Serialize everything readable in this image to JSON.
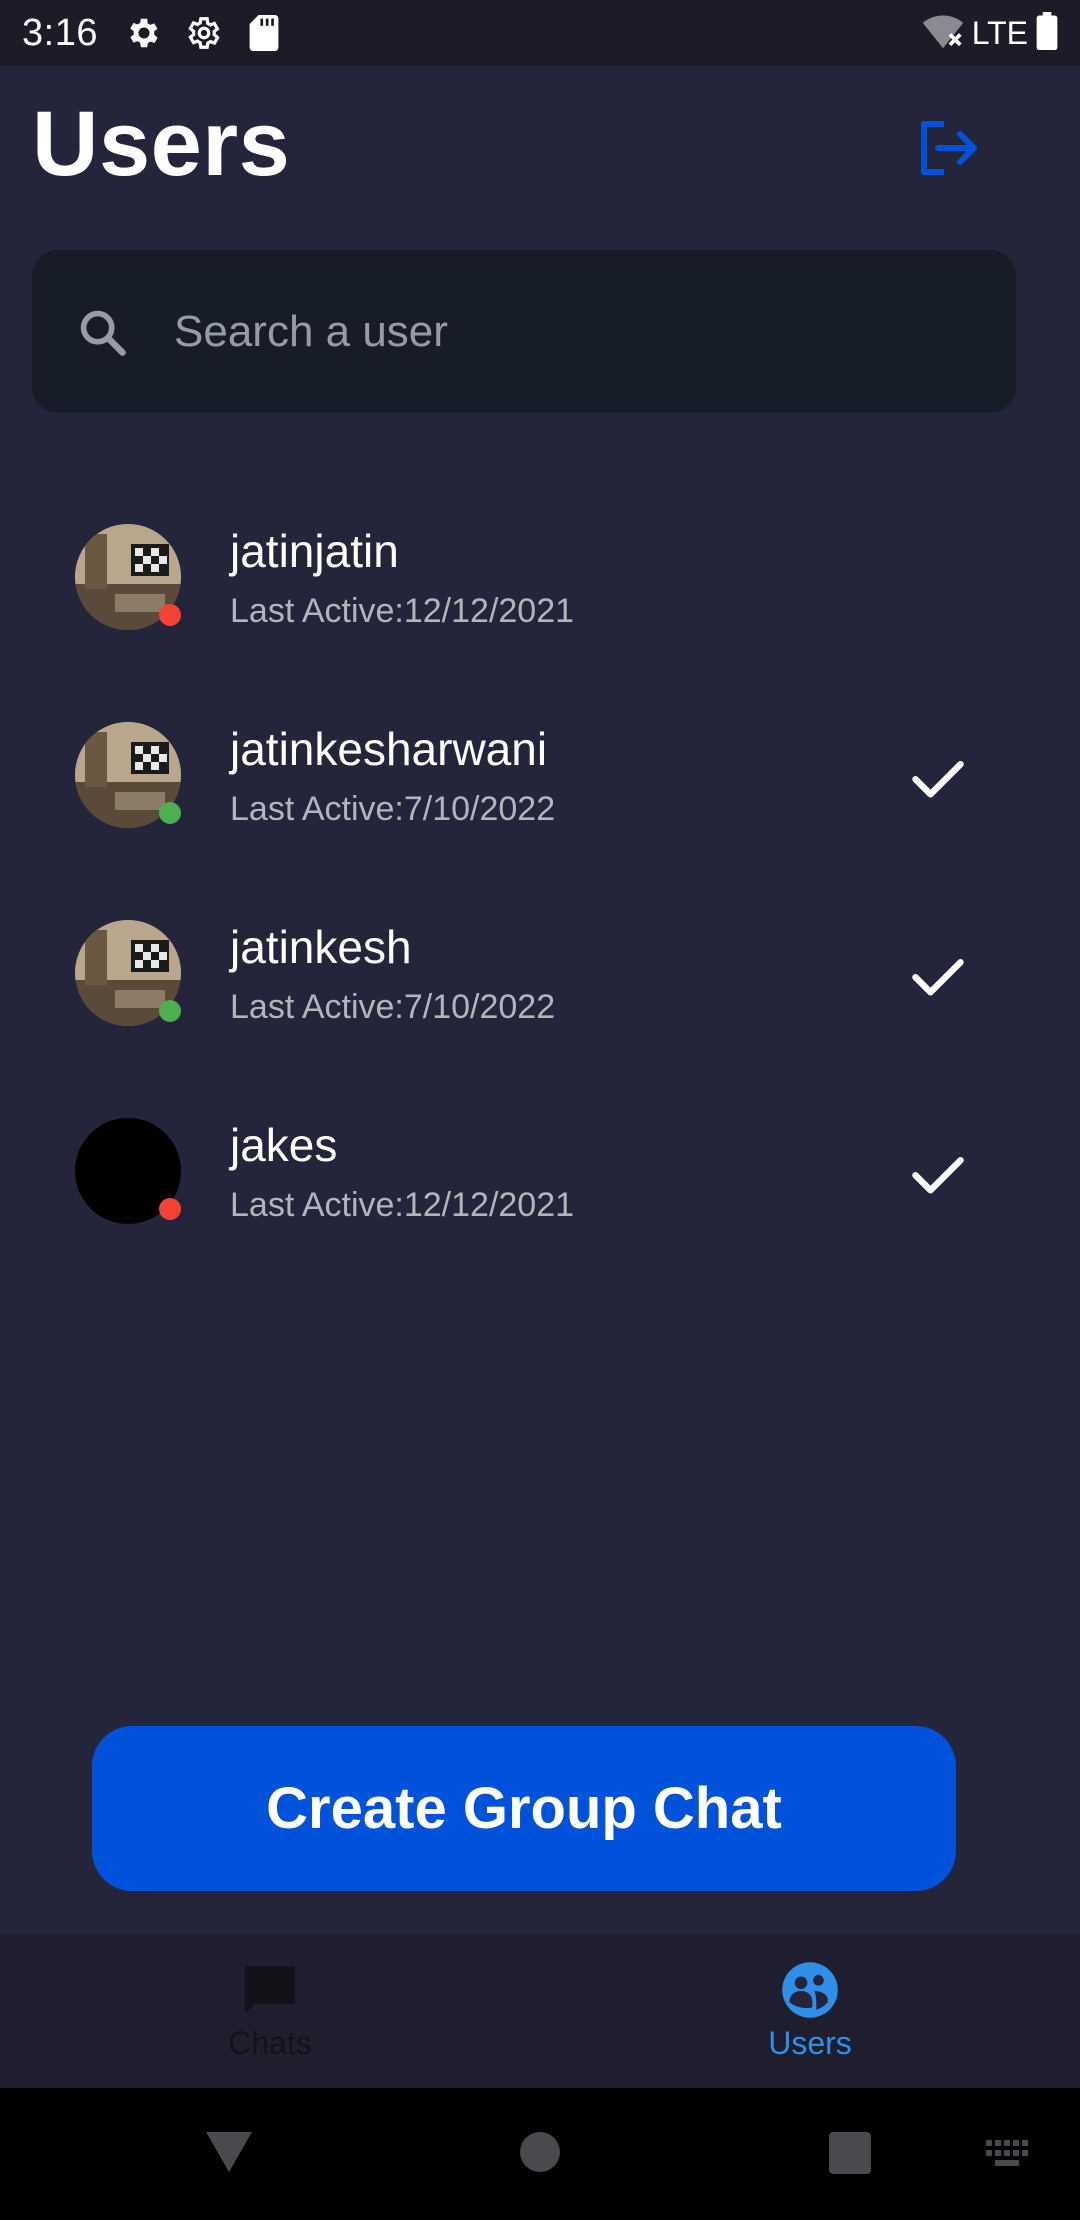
{
  "status_bar": {
    "time": "3:16",
    "network": "LTE",
    "icons": [
      "settings-gear-icon",
      "settings-gear-outline-icon",
      "sd-card-icon",
      "wifi-off-icon",
      "battery-icon"
    ]
  },
  "header": {
    "title": "Users",
    "logout_icon": "logout-icon"
  },
  "search": {
    "placeholder": "Search a user",
    "value": ""
  },
  "users": [
    {
      "name": "jatinjatin",
      "last_active": "Last Active:12/12/2021",
      "online": false,
      "selected": false,
      "avatar": "room-photo"
    },
    {
      "name": "jatinkesharwani",
      "last_active": "Last Active:7/10/2022",
      "online": true,
      "selected": true,
      "avatar": "room-photo"
    },
    {
      "name": "jatinkesh",
      "last_active": "Last Active:7/10/2022",
      "online": true,
      "selected": true,
      "avatar": "room-photo"
    },
    {
      "name": "jakes",
      "last_active": "Last Active:12/12/2021",
      "online": false,
      "selected": true,
      "avatar": "black"
    }
  ],
  "actions": {
    "create_group_label": "Create Group Chat"
  },
  "bottom_nav": {
    "items": [
      {
        "label": "Chats",
        "icon": "chat-bubble-icon",
        "active": false
      },
      {
        "label": "Users",
        "icon": "users-icon",
        "active": true
      }
    ]
  },
  "colors": {
    "background": "#24243a",
    "accent": "#0052da",
    "active_tab": "#2f8fe8",
    "online": "#4caf50",
    "offline": "#f44336"
  }
}
